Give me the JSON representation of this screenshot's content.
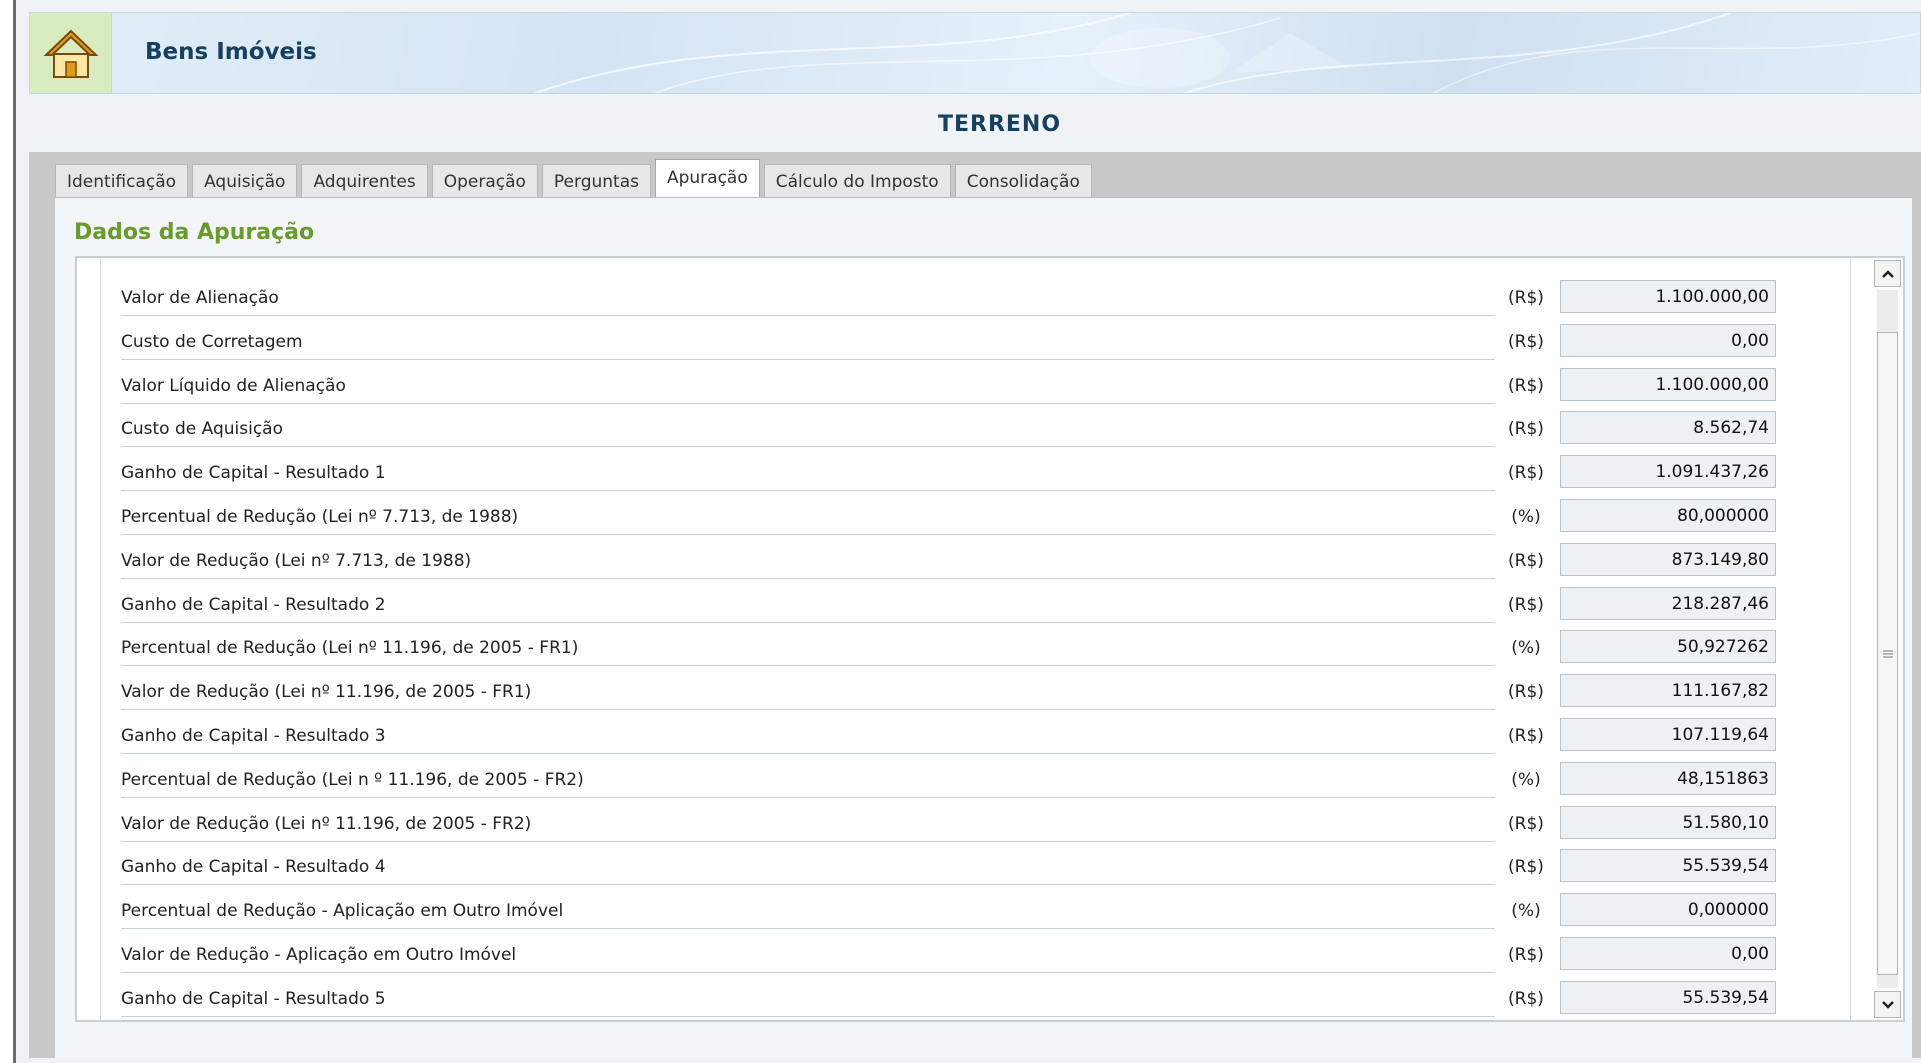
{
  "header": {
    "title": "Bens Imóveis",
    "home_icon": "house-icon"
  },
  "page_title": "TERRENO",
  "tabs": [
    {
      "label": "Identificação"
    },
    {
      "label": "Aquisição"
    },
    {
      "label": "Adquirentes"
    },
    {
      "label": "Operação"
    },
    {
      "label": "Perguntas"
    },
    {
      "label": "Apuração",
      "active": true
    },
    {
      "label": "Cálculo do Imposto"
    },
    {
      "label": "Consolidação"
    }
  ],
  "section_title": "Dados da Apuração",
  "rows": [
    {
      "label": "Valor de Alienação",
      "unit": "(R$)",
      "value": "1.100.000,00"
    },
    {
      "label": "Custo de Corretagem",
      "unit": "(R$)",
      "value": "0,00"
    },
    {
      "label": "Valor Líquido de Alienação",
      "unit": "(R$)",
      "value": "1.100.000,00"
    },
    {
      "label": "Custo de Aquisição",
      "unit": "(R$)",
      "value": "8.562,74"
    },
    {
      "label": "Ganho de Capital - Resultado 1",
      "unit": "(R$)",
      "value": "1.091.437,26"
    },
    {
      "label": "Percentual de Redução (Lei nº 7.713, de 1988)",
      "unit": "(%)",
      "value": "80,000000"
    },
    {
      "label": "Valor de Redução (Lei nº 7.713, de 1988)",
      "unit": "(R$)",
      "value": "873.149,80"
    },
    {
      "label": "Ganho de Capital - Resultado 2",
      "unit": "(R$)",
      "value": "218.287,46"
    },
    {
      "label": "Percentual de Redução (Lei nº 11.196, de 2005 - FR1)",
      "unit": "(%)",
      "value": "50,927262"
    },
    {
      "label": "Valor de Redução (Lei nº 11.196, de 2005 - FR1)",
      "unit": "(R$)",
      "value": "111.167,82"
    },
    {
      "label": "Ganho de Capital - Resultado 3",
      "unit": "(R$)",
      "value": "107.119,64"
    },
    {
      "label": "Percentual de Redução (Lei n º 11.196, de 2005 - FR2)",
      "unit": "(%)",
      "value": "48,151863"
    },
    {
      "label": "Valor de Redução (Lei nº 11.196, de 2005 - FR2)",
      "unit": "(R$)",
      "value": "51.580,10"
    },
    {
      "label": "Ganho de Capital - Resultado 4",
      "unit": "(R$)",
      "value": "55.539,54"
    },
    {
      "label": "Percentual de Redução - Aplicação em Outro Imóvel",
      "unit": "(%)",
      "value": "0,000000"
    },
    {
      "label": "Valor de Redução - Aplicação em Outro Imóvel",
      "unit": "(R$)",
      "value": "0,00"
    },
    {
      "label": "Ganho de Capital - Resultado 5",
      "unit": "(R$)",
      "value": "55.539,54"
    }
  ],
  "scrollbar": {
    "up_icon": "chevron-up-icon",
    "down_icon": "chevron-down-icon",
    "grip_icon": "grip-icon"
  }
}
